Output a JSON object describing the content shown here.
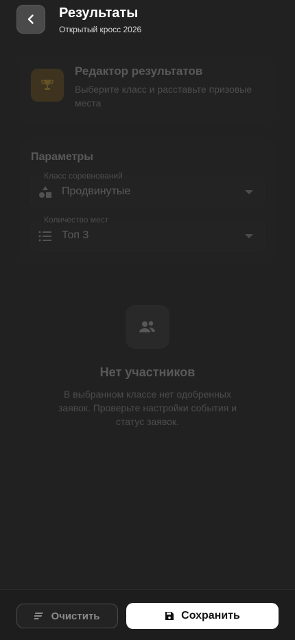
{
  "header": {
    "title": "Результаты",
    "subtitle": "Открытый кросс 2026",
    "back_icon": "chevron-left-icon"
  },
  "editor": {
    "title": "Редактор результатов",
    "subtitle": "Выберите класс и расставьте призовые места",
    "icon": "trophy-icon",
    "accent": "#f2b632"
  },
  "params": {
    "title": "Параметры",
    "class_field": {
      "label": "Класс соревнований",
      "value": "Продвинутые",
      "icon": "shapes-icon"
    },
    "places_field": {
      "label": "Количество мест",
      "value": "Топ 3",
      "icon": "list-icon"
    }
  },
  "empty_state": {
    "title": "Нет участников",
    "text": "В выбранном классе нет одобренных заявок. Проверьте настройки события и статус заявок.",
    "icon": "people-icon"
  },
  "footer": {
    "clear_label": "Очистить",
    "save_label": "Сохранить",
    "clear_icon": "clear-lines-icon",
    "save_icon": "floppy-disk-icon"
  }
}
